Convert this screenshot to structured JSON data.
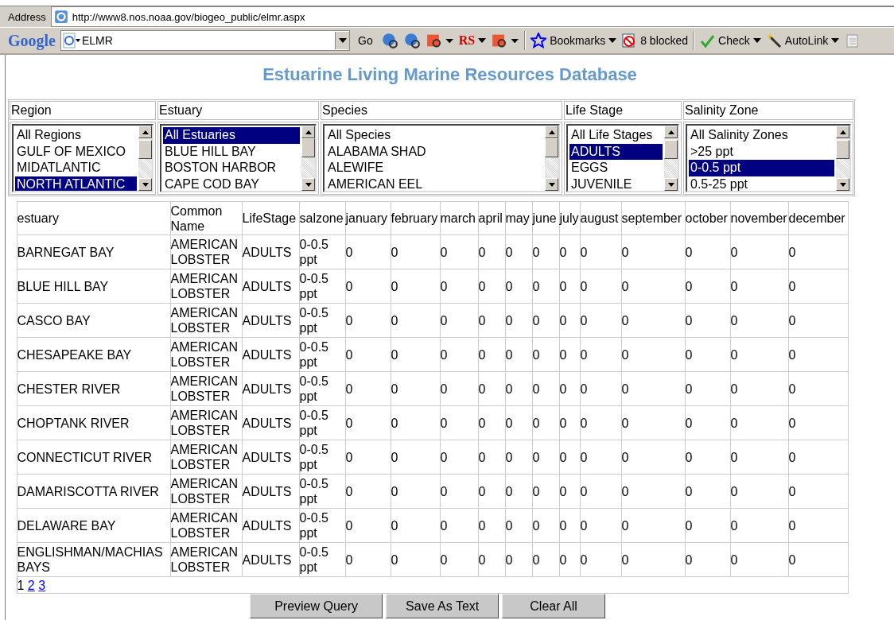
{
  "address_bar": {
    "label": "Address",
    "url": "http://www8.nos.noaa.gov/biogeo_public/elmr.aspx"
  },
  "toolbar": {
    "logo": "Google",
    "search_value": "ELMR",
    "go": "Go",
    "items": [
      {
        "kind": "icon"
      },
      {
        "kind": "icon"
      },
      {
        "kind": "menu-icon"
      },
      {
        "kind": "rs",
        "label": "RS"
      },
      {
        "kind": "menu-icon"
      },
      {
        "kind": "sep"
      },
      {
        "kind": "bookmarks",
        "label": "Bookmarks"
      },
      {
        "kind": "blocked",
        "label": "8 blocked"
      },
      {
        "kind": "sep"
      },
      {
        "kind": "check",
        "label": "Check"
      },
      {
        "kind": "autolink",
        "label": "AutoLink"
      },
      {
        "kind": "disabled-icon"
      }
    ]
  },
  "title": "Estuarine Living Marine Resources Database",
  "filters": [
    {
      "label": "Region",
      "options": [
        {
          "text": "All Regions",
          "selected": false
        },
        {
          "text": "GULF OF MEXICO",
          "selected": false
        },
        {
          "text": "MIDATLANTIC",
          "selected": false
        },
        {
          "text": "NORTH ATLANTIC",
          "selected": true
        }
      ]
    },
    {
      "label": "Estuary",
      "options": [
        {
          "text": "All Estuaries",
          "selected": true
        },
        {
          "text": "BLUE HILL BAY",
          "selected": false
        },
        {
          "text": "BOSTON HARBOR",
          "selected": false
        },
        {
          "text": "CAPE COD BAY",
          "selected": false
        }
      ]
    },
    {
      "label": "Species",
      "options": [
        {
          "text": "All Species",
          "selected": false
        },
        {
          "text": "ALABAMA SHAD",
          "selected": false
        },
        {
          "text": "ALEWIFE",
          "selected": false
        },
        {
          "text": "AMERICAN EEL",
          "selected": false
        }
      ]
    },
    {
      "label": "Life Stage",
      "options": [
        {
          "text": "All Life Stages",
          "selected": false
        },
        {
          "text": "ADULTS",
          "selected": true
        },
        {
          "text": "EGGS",
          "selected": false
        },
        {
          "text": "JUVENILE",
          "selected": false
        }
      ]
    },
    {
      "label": "Salinity Zone",
      "options": [
        {
          "text": "All Salinity Zones",
          "selected": false
        },
        {
          "text": ">25 ppt",
          "selected": false
        },
        {
          "text": "0-0.5 ppt",
          "selected": true
        },
        {
          "text": "0.5-25 ppt",
          "selected": false
        }
      ]
    }
  ],
  "table": {
    "columns": [
      "estuary",
      "Common Name",
      "LifeStage",
      "salzone",
      "january",
      "february",
      "march",
      "april",
      "may",
      "june",
      "july",
      "august",
      "september",
      "october",
      "november",
      "december"
    ],
    "rows": [
      [
        "BARNEGAT BAY",
        "AMERICAN LOBSTER",
        "ADULTS",
        "0-0.5 ppt",
        "0",
        "0",
        "0",
        "0",
        "0",
        "0",
        "0",
        "0",
        "0",
        "0",
        "0",
        "0"
      ],
      [
        "BLUE HILL BAY",
        "AMERICAN LOBSTER",
        "ADULTS",
        "0-0.5 ppt",
        "0",
        "0",
        "0",
        "0",
        "0",
        "0",
        "0",
        "0",
        "0",
        "0",
        "0",
        "0"
      ],
      [
        "CASCO BAY",
        "AMERICAN LOBSTER",
        "ADULTS",
        "0-0.5 ppt",
        "0",
        "0",
        "0",
        "0",
        "0",
        "0",
        "0",
        "0",
        "0",
        "0",
        "0",
        "0"
      ],
      [
        "CHESAPEAKE BAY",
        "AMERICAN LOBSTER",
        "ADULTS",
        "0-0.5 ppt",
        "0",
        "0",
        "0",
        "0",
        "0",
        "0",
        "0",
        "0",
        "0",
        "0",
        "0",
        "0"
      ],
      [
        "CHESTER RIVER",
        "AMERICAN LOBSTER",
        "ADULTS",
        "0-0.5 ppt",
        "0",
        "0",
        "0",
        "0",
        "0",
        "0",
        "0",
        "0",
        "0",
        "0",
        "0",
        "0"
      ],
      [
        "CHOPTANK RIVER",
        "AMERICAN LOBSTER",
        "ADULTS",
        "0-0.5 ppt",
        "0",
        "0",
        "0",
        "0",
        "0",
        "0",
        "0",
        "0",
        "0",
        "0",
        "0",
        "0"
      ],
      [
        "CONNECTICUT RIVER",
        "AMERICAN LOBSTER",
        "ADULTS",
        "0-0.5 ppt",
        "0",
        "0",
        "0",
        "0",
        "0",
        "0",
        "0",
        "0",
        "0",
        "0",
        "0",
        "0"
      ],
      [
        "DAMARISCOTTA RIVER",
        "AMERICAN LOBSTER",
        "ADULTS",
        "0-0.5 ppt",
        "0",
        "0",
        "0",
        "0",
        "0",
        "0",
        "0",
        "0",
        "0",
        "0",
        "0",
        "0"
      ],
      [
        "DELAWARE BAY",
        "AMERICAN LOBSTER",
        "ADULTS",
        "0-0.5 ppt",
        "0",
        "0",
        "0",
        "0",
        "0",
        "0",
        "0",
        "0",
        "0",
        "0",
        "0",
        "0"
      ],
      [
        "ENGLISHMAN/MACHIAS BAYS",
        "AMERICAN LOBSTER",
        "ADULTS",
        "0-0.5 ppt",
        "0",
        "0",
        "0",
        "0",
        "0",
        "0",
        "0",
        "0",
        "0",
        "0",
        "0",
        "0"
      ]
    ]
  },
  "pagination": [
    {
      "label": "1",
      "selected": true
    },
    {
      "label": "2",
      "selected": false
    },
    {
      "label": "3",
      "selected": false
    }
  ],
  "buttons": [
    "Preview Query",
    "Save As Text",
    "Clear All"
  ]
}
